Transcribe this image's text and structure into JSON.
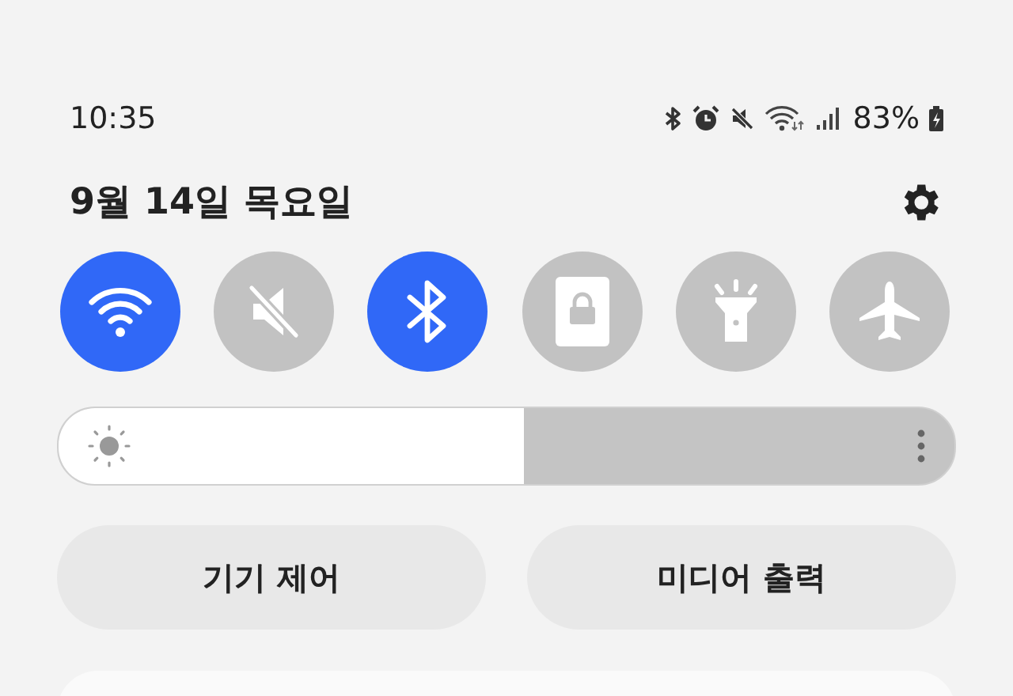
{
  "status_bar": {
    "time": "10:35",
    "battery": "83%"
  },
  "header": {
    "date": "9월 14일 목요일"
  },
  "toggles": [
    {
      "kind": "wifi",
      "on": true
    },
    {
      "kind": "mute",
      "on": false
    },
    {
      "kind": "bluetooth",
      "on": true
    },
    {
      "kind": "lock",
      "on": false
    },
    {
      "kind": "flashlight",
      "on": false
    },
    {
      "kind": "airplane",
      "on": false
    }
  ],
  "brightness": {
    "level": 0.52
  },
  "buttons": [
    {
      "label": "기기 제어"
    },
    {
      "label": "미디어 출력"
    }
  ]
}
